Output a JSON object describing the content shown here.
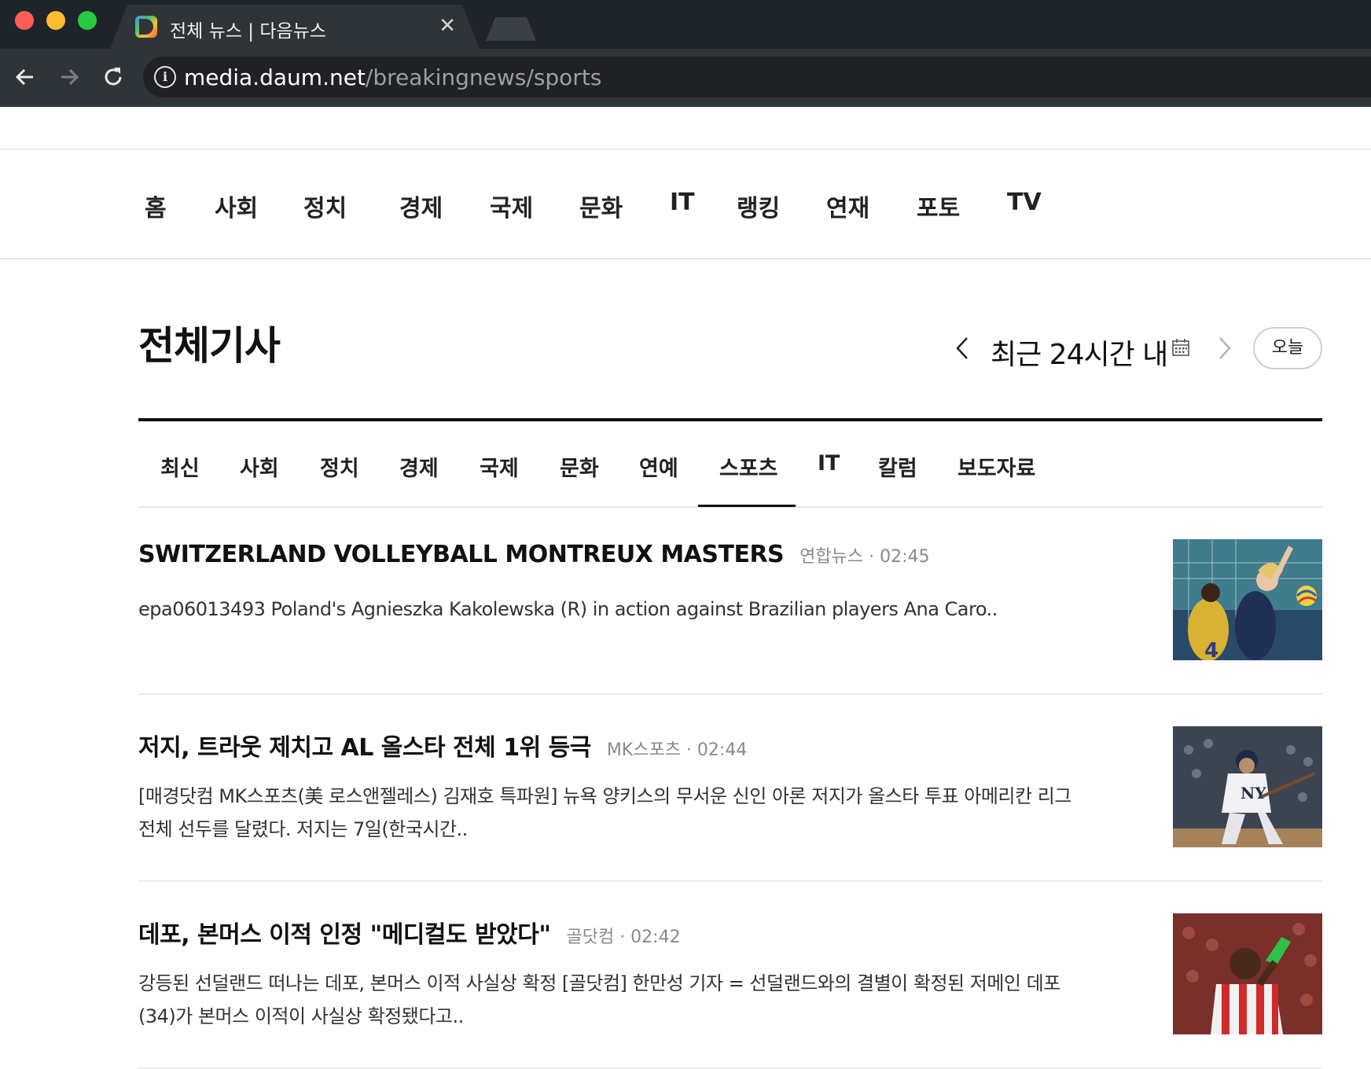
{
  "browser": {
    "tab_title": "전체 뉴스 | 다음뉴스",
    "close_glyph": "✕",
    "url_host": "media.daum.net",
    "url_path": "/breakingnews/sports",
    "info_glyph": "i"
  },
  "gnb": {
    "items": [
      "홈",
      "사회",
      "정치",
      "경제",
      "국제",
      "문화",
      "IT",
      "랭킹",
      "연재",
      "포토",
      "TV"
    ]
  },
  "page": {
    "heading": "전체기사",
    "date_label": "최근 24시간 내",
    "today_button": "오늘"
  },
  "subnav": {
    "items": [
      "최신",
      "사회",
      "정치",
      "경제",
      "국제",
      "문화",
      "연예",
      "스포츠",
      "IT",
      "칼럼",
      "보도자료"
    ],
    "active": "스포츠"
  },
  "articles": [
    {
      "title": "SWITZERLAND VOLLEYBALL MONTREUX MASTERS",
      "source": "연합뉴스",
      "time": "02:45",
      "meta": "연합뉴스 · 02:45",
      "desc": "epa06013493 Poland's Agnieszka Kakolewska (R) in action against Brazilian players Ana Caro..",
      "thumb_icon": "volleyball-photo"
    },
    {
      "title": "저지, 트라웃 제치고 AL 올스타 전체 1위 등극",
      "source": "MK스포츠",
      "time": "02:44",
      "meta": "MK스포츠 · 02:44",
      "desc": "[매경닷컴 MK스포츠(美 로스앤젤레스) 김재호 특파원] 뉴욕 양키스의 무서운 신인 아론 저지가 올스타 투표 아메리칸 리그 전체 선두를 달렸다. 저지는 7일(한국시간..",
      "thumb_icon": "baseball-photo"
    },
    {
      "title": "데포, 본머스 이적 인정 \"메디컬도 받았다\"",
      "source": "골닷컴",
      "time": "02:42",
      "meta": "골닷컴 · 02:42",
      "desc": "강등된 선덜랜드 떠나는 데포, 본머스 이적 사실상 확정 [골닷컴] 한만성 기자 = 선덜랜드와의 결별이 확정된 저메인 데포(34)가 본머스 이적이 사실상 확정됐다고..",
      "thumb_icon": "soccer-photo"
    }
  ],
  "colors": {
    "chrome_dark": "#1f242a",
    "chrome_toolbar": "#2f3438",
    "text_main": "#111111",
    "meta_gray": "#8a8a8a"
  }
}
